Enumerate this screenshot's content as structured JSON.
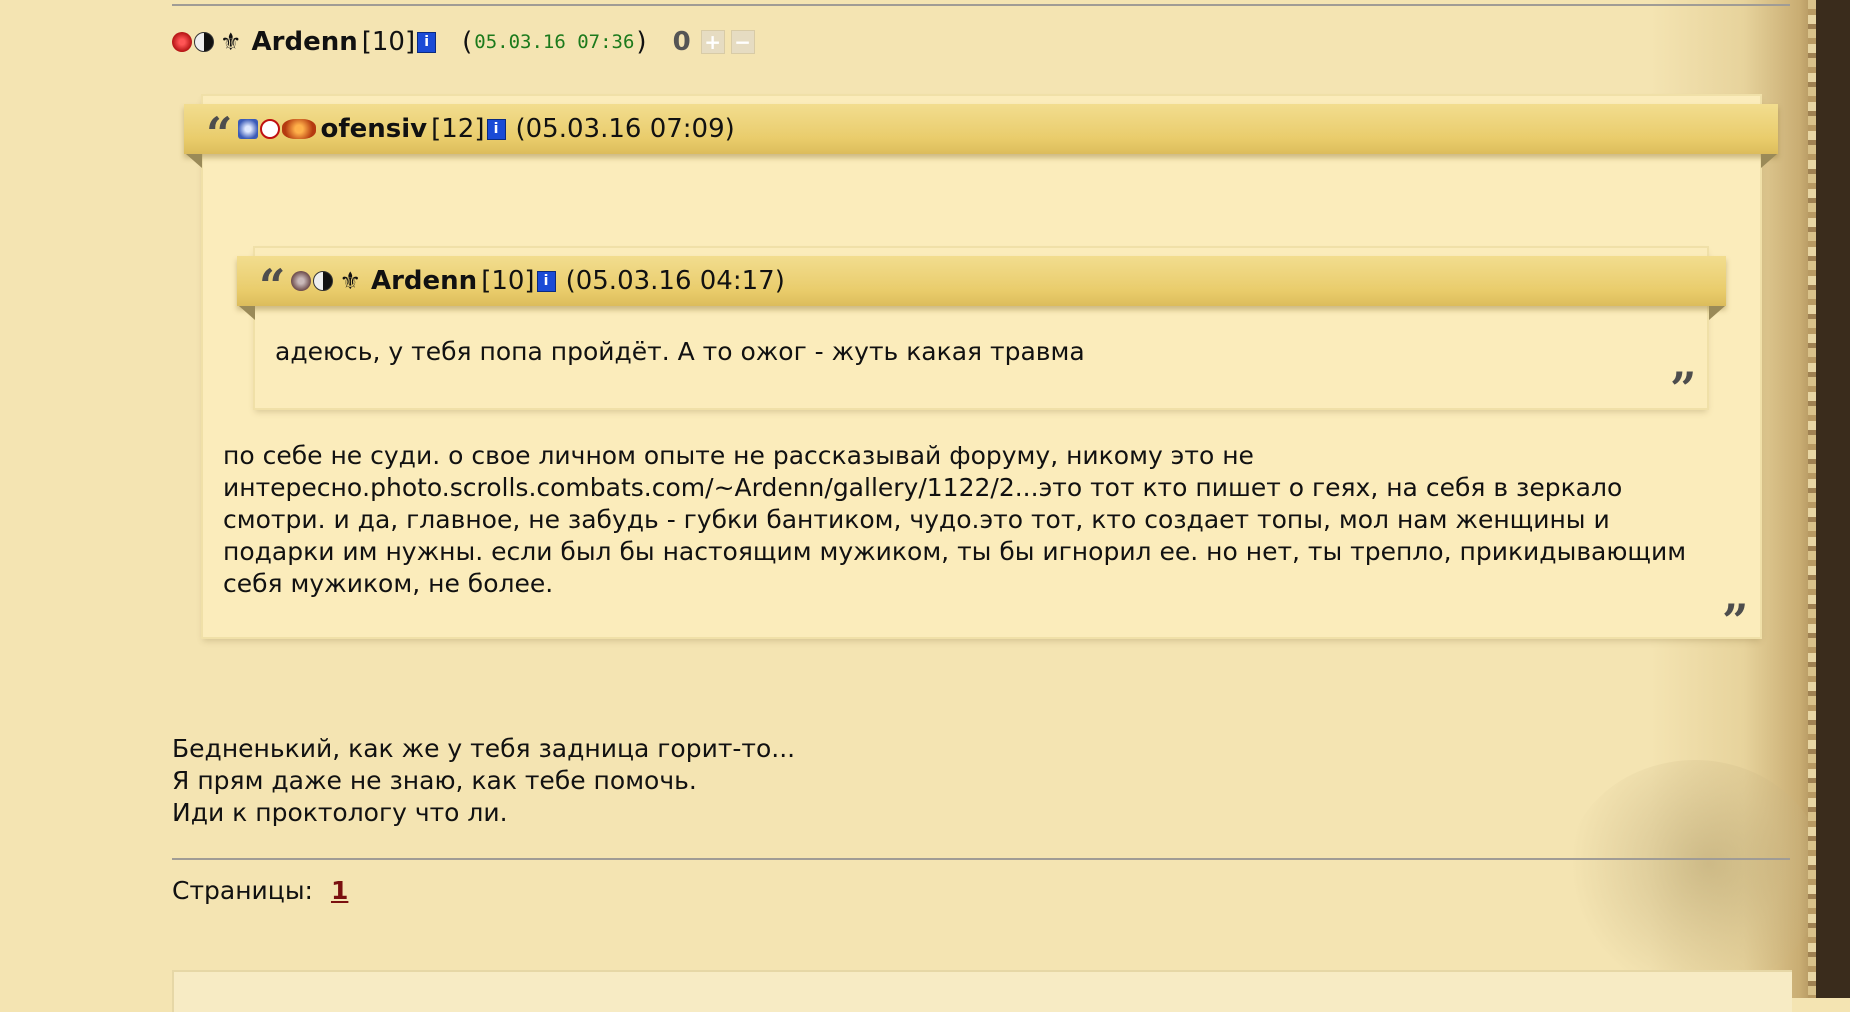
{
  "post": {
    "author": "Ardenn",
    "level": "[10]",
    "date_open": "(",
    "date": "05.03.16 07:36",
    "date_close": ")",
    "rating": "0",
    "vote_plus": "+",
    "vote_minus": "−",
    "info_glyph": "i",
    "lily_glyph": "⚜"
  },
  "quote_outer": {
    "author": "ofensiv",
    "level": "[12]",
    "date": "(05.03.16 07:09)",
    "open_mark": "“",
    "close_mark": "”",
    "text_lines": [
      "по себе не суди. о свое личном опыте не рассказывай форуму, никому это не",
      "интересно.photo.scrolls.combats.com/~Ardenn/gallery/1122/2...это тот кто пишет о геях, на себя в зеркало",
      "смотри. и да, главное, не забудь - губки бантиком, чудо.это тот, кто создает топы, мол нам женщины и",
      "подарки им нужны. если был бы настоящим мужиком, ты бы игнорил ее. но нет, ты трепло, прикидывающим",
      "себя мужиком, не более."
    ]
  },
  "quote_inner": {
    "author": "Ardenn",
    "level": "[10]",
    "date": "(05.03.16 04:17)",
    "open_mark": "“",
    "close_mark": "”",
    "text": "адеюсь, у тебя попа пройдёт. А то ожог - жуть какая травма"
  },
  "reply_lines": [
    "Бедненький, как же у тебя задница горит-то...",
    "Я прям даже не знаю, как тебе помочь.",
    "Иди к проктологу что ли."
  ],
  "pagination": {
    "label": "Страницы:",
    "pages": [
      "1"
    ]
  },
  "icons": [
    "fire-badge-icon",
    "yin-yang-icon",
    "fleur-de-lis-icon",
    "info-icon",
    "shield-badge-icon",
    "red-cross-icon",
    "dragon-badge-icon",
    "skull-badge-icon",
    "plus-icon",
    "minus-icon"
  ]
}
